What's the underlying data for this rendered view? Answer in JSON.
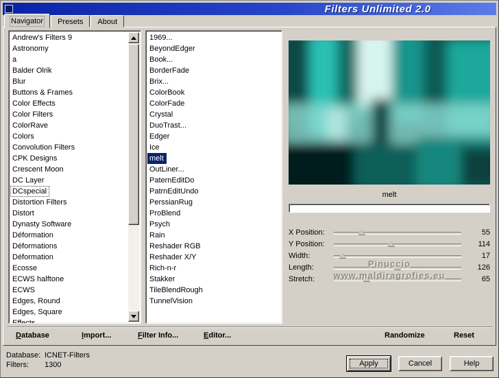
{
  "window": {
    "title": "Filters Unlimited 2.0"
  },
  "tabs": [
    {
      "label": "Navigator"
    },
    {
      "label": "Presets"
    },
    {
      "label": "About"
    }
  ],
  "categories": {
    "selected": "DCspecial",
    "items": [
      "Andrew's Filters 9",
      "Astronomy",
      "a",
      "Balder Olrik",
      "Blur",
      "Buttons & Frames",
      "Color Effects",
      "Color Filters",
      "ColorRave",
      "Colors",
      "Convolution Filters",
      "CPK Designs",
      "Crescent Moon",
      "DC Layer",
      "DCspecial",
      "Distortion Filters",
      "Distort",
      "Dynasty Software",
      "Déformation",
      "Déformations",
      "Déformation",
      "Ecosse",
      "ECWS halftone",
      "ECWS",
      "Edges, Round",
      "Edges, Square",
      "Effects"
    ]
  },
  "filters": {
    "selected": "melt",
    "items": [
      "1969...",
      "BeyondEdger",
      "Book...",
      "BorderFade",
      "Brix...",
      "ColorBook",
      "ColorFade",
      "Crystal",
      "DuoTrast...",
      "Edger",
      "Ice",
      "melt",
      "OutLiner...",
      "PaternEditDo",
      "PatrnEditUndo",
      "PerssianRug",
      "ProBlend",
      "Psych",
      "Rain",
      "Reshader RGB",
      "Reshader X/Y",
      "Rich-n-r",
      "Stakker",
      "TileBlendRough",
      "TunnelVision"
    ]
  },
  "preview": {
    "filter_name": "melt",
    "progress_percent": 0
  },
  "params": [
    {
      "label": "X Position:",
      "value": 55,
      "max": 255
    },
    {
      "label": "Y Position:",
      "value": 114,
      "max": 255
    },
    {
      "label": "Width:",
      "value": 17,
      "max": 255
    },
    {
      "label": "Length:",
      "value": 126,
      "max": 255
    },
    {
      "label": "Stretch:",
      "value": 65,
      "max": 255
    }
  ],
  "watermark": {
    "line1": "Pinuccio",
    "line2": "www.maldiragrofies.eu"
  },
  "toolbar": {
    "items": [
      {
        "label": "Database"
      },
      {
        "label": "Import..."
      },
      {
        "label": "Filter Info..."
      },
      {
        "label": "Editor..."
      },
      {
        "label": "Randomize"
      },
      {
        "label": "Reset"
      }
    ]
  },
  "status": {
    "database_label": "Database:",
    "database_value": "ICNET-Filters",
    "filters_label": "Filters:",
    "filters_value": "1300"
  },
  "action_buttons": [
    {
      "label": "Apply"
    },
    {
      "label": "Cancel"
    },
    {
      "label": "Help"
    }
  ],
  "colors": {
    "titlebar_gradient_start": "#0a23a6",
    "titlebar_gradient_end": "#5b7ce8",
    "selection": "#0a246a",
    "chrome": "#d4d0c8"
  }
}
